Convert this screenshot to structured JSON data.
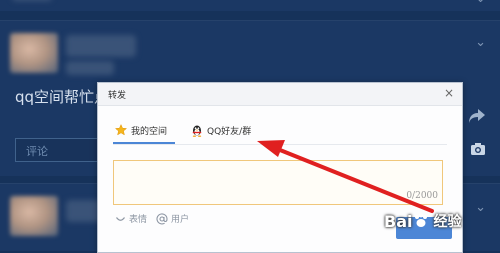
{
  "background": {
    "post_title": "qq空间帮忙点",
    "comment_placeholder": "评论"
  },
  "dialog": {
    "title": "转发",
    "close": "×",
    "tabs": [
      {
        "label": "我的空间",
        "active": true,
        "icon": "star-icon"
      },
      {
        "label": "QQ好友/群",
        "active": false,
        "icon": "qq-penguin-icon"
      }
    ],
    "textarea": {
      "value": "",
      "counter": "0/2000"
    },
    "toolbar": {
      "emoji_label": "表情",
      "mention_label": "用户"
    }
  },
  "annotation": {
    "arrow_color": "#e02020"
  },
  "watermark": {
    "text": "Bai",
    "suffix": "经验"
  },
  "colors": {
    "page_bg": "#16325a",
    "accent": "#4c86d6",
    "textarea_border": "#f0c77b"
  }
}
